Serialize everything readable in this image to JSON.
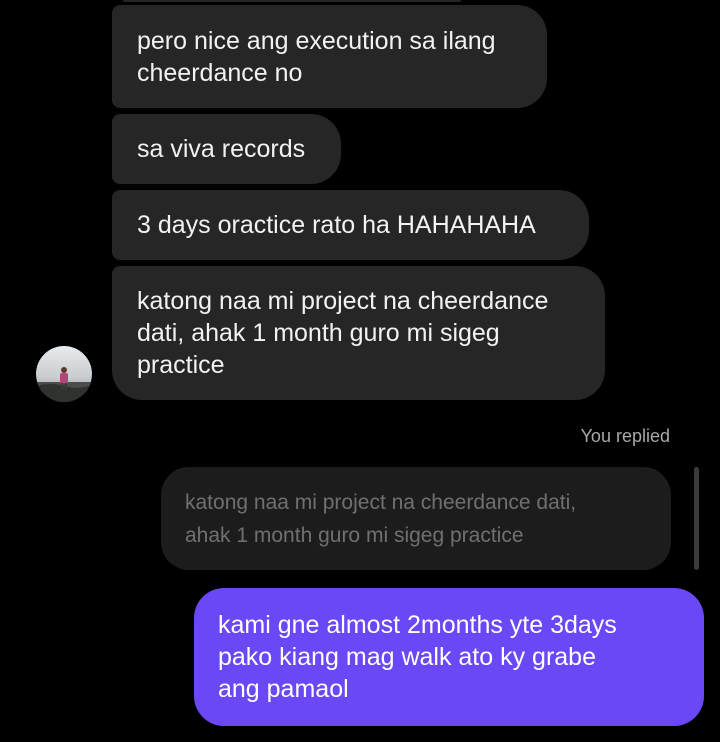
{
  "conversation": {
    "incoming": [
      {
        "lines": [
          "pero nice ang execution sa ilang",
          "cheerdance no"
        ]
      },
      {
        "lines": [
          "sa viva records"
        ]
      },
      {
        "lines": [
          "3 days oractice rato ha HAHAHAHA"
        ]
      },
      {
        "lines": [
          "katong naa mi project na cheerdance",
          "dati, ahak 1 month guro mi sigeg",
          "practice"
        ]
      }
    ],
    "reply_label": "You replied",
    "quoted": {
      "lines": [
        "katong naa mi project na cheerdance dati,",
        "ahak 1 month guro mi sigeg practice"
      ]
    },
    "outgoing": {
      "lines": [
        "kami gne almost 2months yte 3days",
        "pako kiang mag walk ato ky grabe",
        "ang pamaol"
      ]
    }
  },
  "colors": {
    "background": "#000000",
    "incoming_bubble": "#262626",
    "outgoing_bubble": "#6a48f5",
    "quoted_bubble": "#1c1c1c"
  },
  "icons": {
    "avatar": "profile-photo-avatar"
  }
}
